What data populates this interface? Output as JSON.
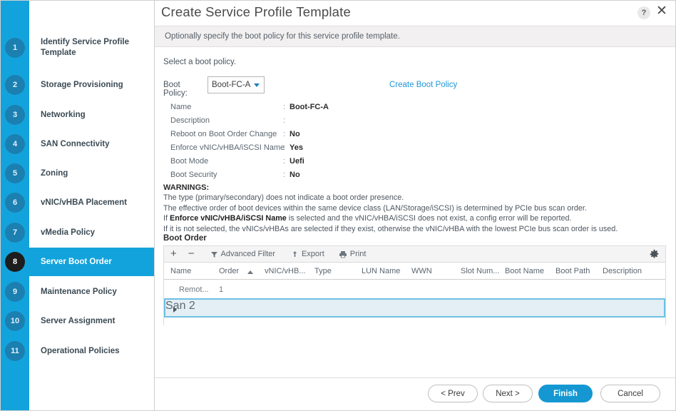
{
  "window": {
    "title": "Create Service Profile Template",
    "subtitle": "Optionally specify the boot policy for this service profile template.",
    "help_icon": "?",
    "close_icon": "✕",
    "accent_color": "#13A3DC"
  },
  "sidebar": {
    "steps": [
      {
        "num": "1",
        "label": "Identify Service Profile Template",
        "active": false
      },
      {
        "num": "2",
        "label": "Storage Provisioning",
        "active": false
      },
      {
        "num": "3",
        "label": "Networking",
        "active": false
      },
      {
        "num": "4",
        "label": "SAN Connectivity",
        "active": false
      },
      {
        "num": "5",
        "label": "Zoning",
        "active": false
      },
      {
        "num": "6",
        "label": "vNIC/vHBA Placement",
        "active": false
      },
      {
        "num": "7",
        "label": "vMedia Policy",
        "active": false
      },
      {
        "num": "8",
        "label": "Server Boot Order",
        "active": true
      },
      {
        "num": "9",
        "label": "Maintenance Policy",
        "active": false
      },
      {
        "num": "10",
        "label": "Server Assignment",
        "active": false
      },
      {
        "num": "11",
        "label": "Operational Policies",
        "active": false
      }
    ]
  },
  "main": {
    "lead": "Select a boot policy.",
    "boot_policy": {
      "label": "Boot Policy:",
      "selected": "Boot-FC-A",
      "options": [
        "Boot-FC-A"
      ],
      "create_link": "Create Boot Policy"
    },
    "details": [
      {
        "label": "Name",
        "value": "Boot-FC-A"
      },
      {
        "label": "Description",
        "value": ""
      },
      {
        "label": "Reboot on Boot Order Change",
        "value": "No"
      },
      {
        "label": "Enforce vNIC/vHBA/iSCSI Name",
        "value": "Yes"
      },
      {
        "label": "Boot Mode",
        "value": "Uefi"
      },
      {
        "label": "Boot Security",
        "value": "No"
      }
    ],
    "warnings": {
      "title": "WARNINGS:",
      "line1": "The type (primary/secondary) does not indicate a boot order presence.",
      "line2": "The effective order of boot devices within the same device class (LAN/Storage/iSCSI) is determined by PCIe bus scan order.",
      "line3_pre": "If ",
      "line3_bold": "Enforce vNIC/vHBA/iSCSI Name",
      "line3_post": " is selected and the vNIC/vHBA/iSCSI does not exist, a config error will be reported.",
      "line4": "If it is not selected, the vNICs/vHBAs are selected if they exist, otherwise the vNIC/vHBA with the lowest PCIe bus scan order is used."
    },
    "boot_order": {
      "title": "Boot Order",
      "toolbar": {
        "add": "+",
        "remove": "−",
        "filter": "Advanced Filter",
        "export": "Export",
        "print": "Print",
        "settings_icon": "gear-icon"
      },
      "columns": [
        "Name",
        "Order",
        "vNIC/vHB...",
        "Type",
        "LUN Name",
        "WWN",
        "Slot Num...",
        "Boot Name",
        "Boot Path",
        "Description"
      ],
      "sort_column": "Order",
      "sort_direction": "asc",
      "rows": [
        {
          "name": "Remot...",
          "order": "1",
          "selected": false,
          "expandable": false
        },
        {
          "name": "San",
          "order": "2",
          "selected": true,
          "expandable": true
        }
      ]
    }
  },
  "footer": {
    "prev": "< Prev",
    "next": "Next >",
    "finish": "Finish",
    "cancel": "Cancel"
  }
}
